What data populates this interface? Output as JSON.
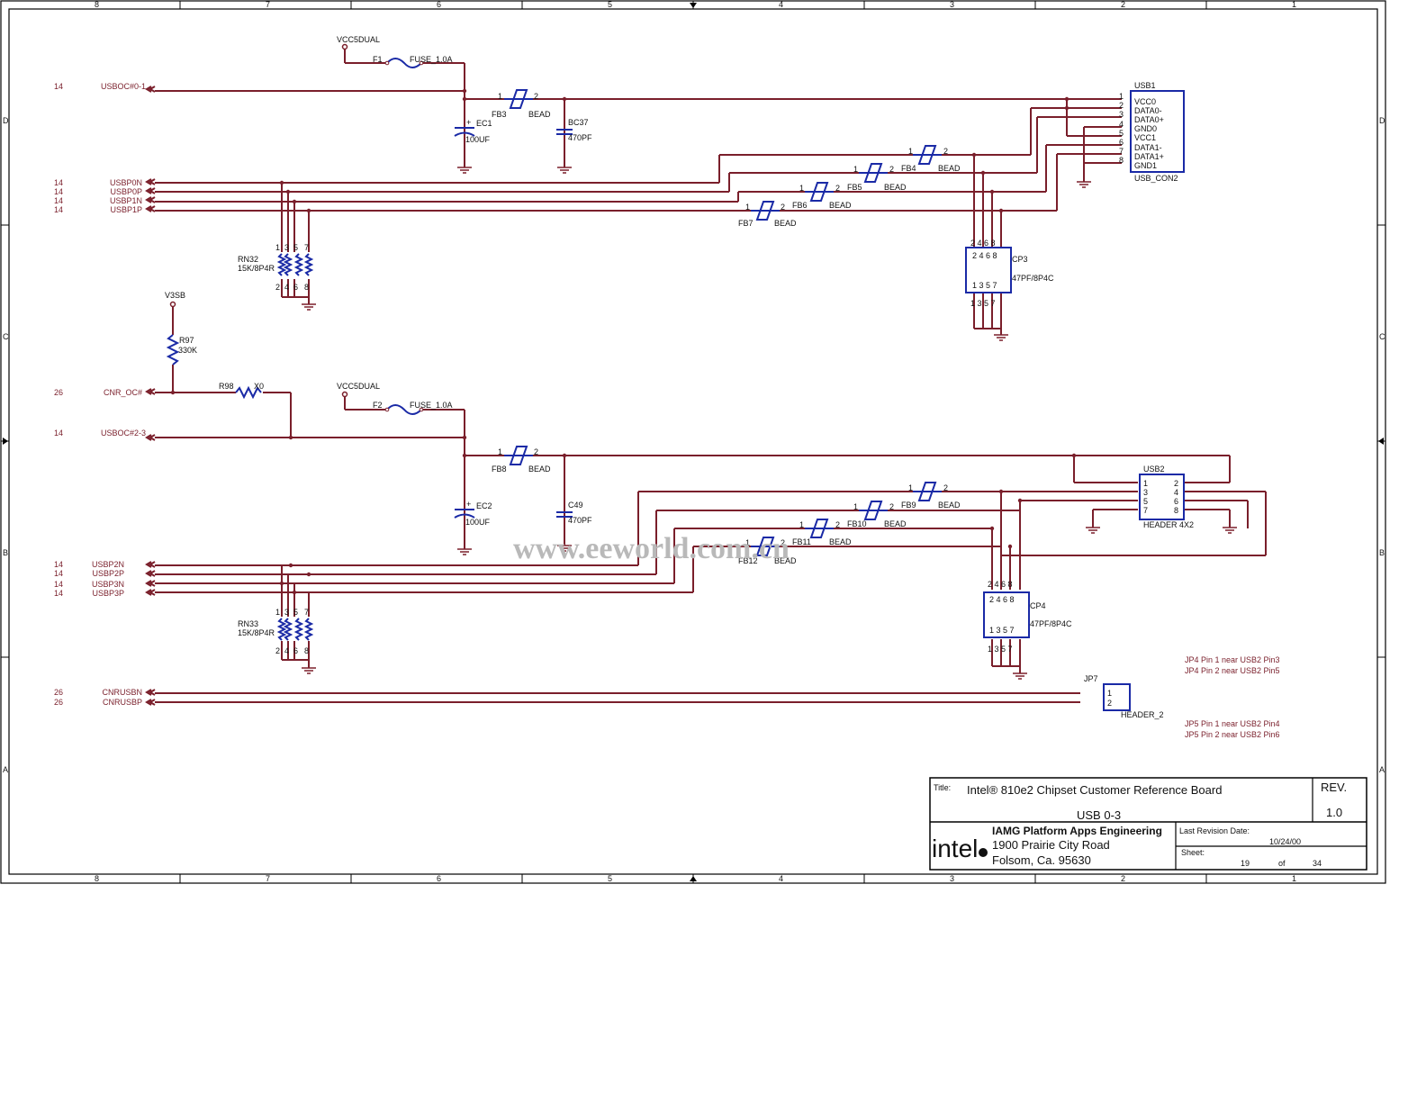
{
  "border": {
    "columns": [
      "8",
      "7",
      "6",
      "5",
      "4",
      "3",
      "2",
      "1"
    ],
    "rows": [
      "D",
      "C",
      "B",
      "A"
    ]
  },
  "power": {
    "vcc5dual_1": "VCC5DUAL",
    "vcc5dual_2": "VCC5DUAL",
    "v3sb": "V3SB"
  },
  "fuses": {
    "f1_ref": "F1",
    "f1_value": "FUSE_1.0A",
    "f2_ref": "F2",
    "f2_value": "FUSE_1.0A"
  },
  "capacitors": {
    "ec1_ref": "EC1",
    "ec1_value": "100UF",
    "bc37_ref": "BC37",
    "bc37_value": "470PF",
    "ec2_ref": "EC2",
    "ec2_value": "100UF",
    "c49_ref": "C49",
    "c49_value": "470PF",
    "cp3_ref": "CP3",
    "cp3_value": "47PF/8P4C",
    "cp4_ref": "CP4",
    "cp4_value": "47PF/8P4C"
  },
  "resistors": {
    "r97_ref": "R97",
    "r97_value": "330K",
    "r98_ref": "R98",
    "r98_value": "X0",
    "rn32_ref": "RN32",
    "rn32_value": "15K/8P4R",
    "rn33_ref": "RN33",
    "rn33_value": "15K/8P4R"
  },
  "beads": [
    {
      "ref": "FB3",
      "value": "BEAD"
    },
    {
      "ref": "FB4",
      "value": "BEAD"
    },
    {
      "ref": "FB5",
      "value": "BEAD"
    },
    {
      "ref": "FB6",
      "value": "BEAD"
    },
    {
      "ref": "FB7",
      "value": "BEAD"
    },
    {
      "ref": "FB8",
      "value": "BEAD"
    },
    {
      "ref": "FB9",
      "value": "BEAD"
    },
    {
      "ref": "FB10",
      "value": "BEAD"
    },
    {
      "ref": "FB11",
      "value": "BEAD"
    },
    {
      "ref": "FB12",
      "value": "BEAD"
    }
  ],
  "nets_left": [
    {
      "page": "14",
      "name": "USBOC#0-1"
    },
    {
      "page": "14",
      "name": "USBP0N"
    },
    {
      "page": "14",
      "name": "USBP0P"
    },
    {
      "page": "14",
      "name": "USBP1N"
    },
    {
      "page": "14",
      "name": "USBP1P"
    },
    {
      "page": "26",
      "name": "CNR_OC#"
    },
    {
      "page": "14",
      "name": "USBOC#2-3"
    },
    {
      "page": "14",
      "name": "USBP2N"
    },
    {
      "page": "14",
      "name": "USBP2P"
    },
    {
      "page": "14",
      "name": "USBP3N"
    },
    {
      "page": "14",
      "name": "USBP3P"
    },
    {
      "page": "26",
      "name": "CNRUSBN"
    },
    {
      "page": "26",
      "name": "CNRUSBP"
    }
  ],
  "usb1": {
    "ref": "USB1",
    "part": "USB_CON2",
    "pins": [
      "VCC0",
      "DATA0-",
      "DATA0+",
      "GND0",
      "VCC1",
      "DATA1-",
      "DATA1+",
      "GND1"
    ],
    "pin_numbers": [
      "1",
      "2",
      "3",
      "4",
      "5",
      "6",
      "7",
      "8"
    ]
  },
  "usb2": {
    "ref": "USB2",
    "part": "HEADER 4X2",
    "left_pins": [
      "1",
      "3",
      "5",
      "7"
    ],
    "right_pins": [
      "2",
      "4",
      "6",
      "8"
    ]
  },
  "jp7": {
    "ref": "JP7",
    "part": "HEADER_2",
    "pins": [
      "1",
      "2"
    ]
  },
  "notes": [
    "JP4  Pin 1 near USB2 Pin3",
    "JP4  Pin 2 near USB2 Pin5",
    "JP5  Pin 1 near USB2 Pin4",
    "JP5  Pin 2 near USB2 Pin6"
  ],
  "title_block": {
    "title_label": "Title:",
    "title": "Intel® 810e2 Chipset Customer Reference Board",
    "subtitle": "USB 0-3",
    "rev_label": "REV.",
    "rev": "1.0",
    "logo": "intel",
    "org": "IAMG Platform Apps Engineering",
    "address1": "1900 Prairie City Road",
    "address2": "Folsom, Ca. 95630",
    "date_label": "Last Revision Date:",
    "date": "10/24/00",
    "sheet_label": "Sheet:",
    "sheet": "19",
    "of_label": "of",
    "total": "34"
  },
  "watermark": "www.eeworld.com.cn"
}
